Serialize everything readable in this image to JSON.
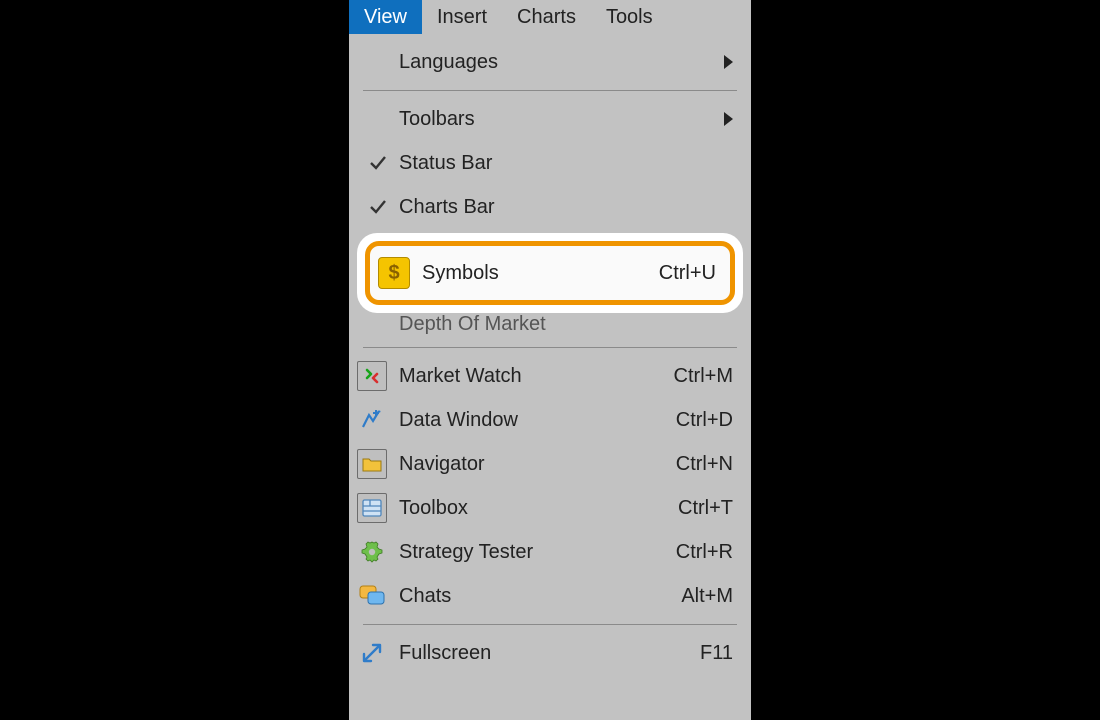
{
  "menubar": {
    "items": [
      {
        "label": "View",
        "active": true
      },
      {
        "label": "Insert",
        "active": false
      },
      {
        "label": "Charts",
        "active": false
      },
      {
        "label": "Tools",
        "active": false
      }
    ]
  },
  "menu": {
    "languages": {
      "label": "Languages"
    },
    "toolbars": {
      "label": "Toolbars"
    },
    "statusbar": {
      "label": "Status Bar"
    },
    "chartsbar": {
      "label": "Charts Bar"
    },
    "symbols": {
      "label": "Symbols",
      "shortcut": "Ctrl+U"
    },
    "depth": {
      "label": "Depth Of Market"
    },
    "marketwatch": {
      "label": "Market Watch",
      "shortcut": "Ctrl+M"
    },
    "datawindow": {
      "label": "Data Window",
      "shortcut": "Ctrl+D"
    },
    "navigator": {
      "label": "Navigator",
      "shortcut": "Ctrl+N"
    },
    "toolbox": {
      "label": "Toolbox",
      "shortcut": "Ctrl+T"
    },
    "strategy": {
      "label": "Strategy Tester",
      "shortcut": "Ctrl+R"
    },
    "chats": {
      "label": "Chats",
      "shortcut": "Alt+M"
    },
    "fullscreen": {
      "label": "Fullscreen",
      "shortcut": "F11"
    }
  },
  "icons": {
    "symbols_glyph": "$"
  },
  "colors": {
    "menubar_active": "#0f6fbe",
    "callout_border": "#ef9400",
    "symbol_icon": "#f5c400"
  }
}
